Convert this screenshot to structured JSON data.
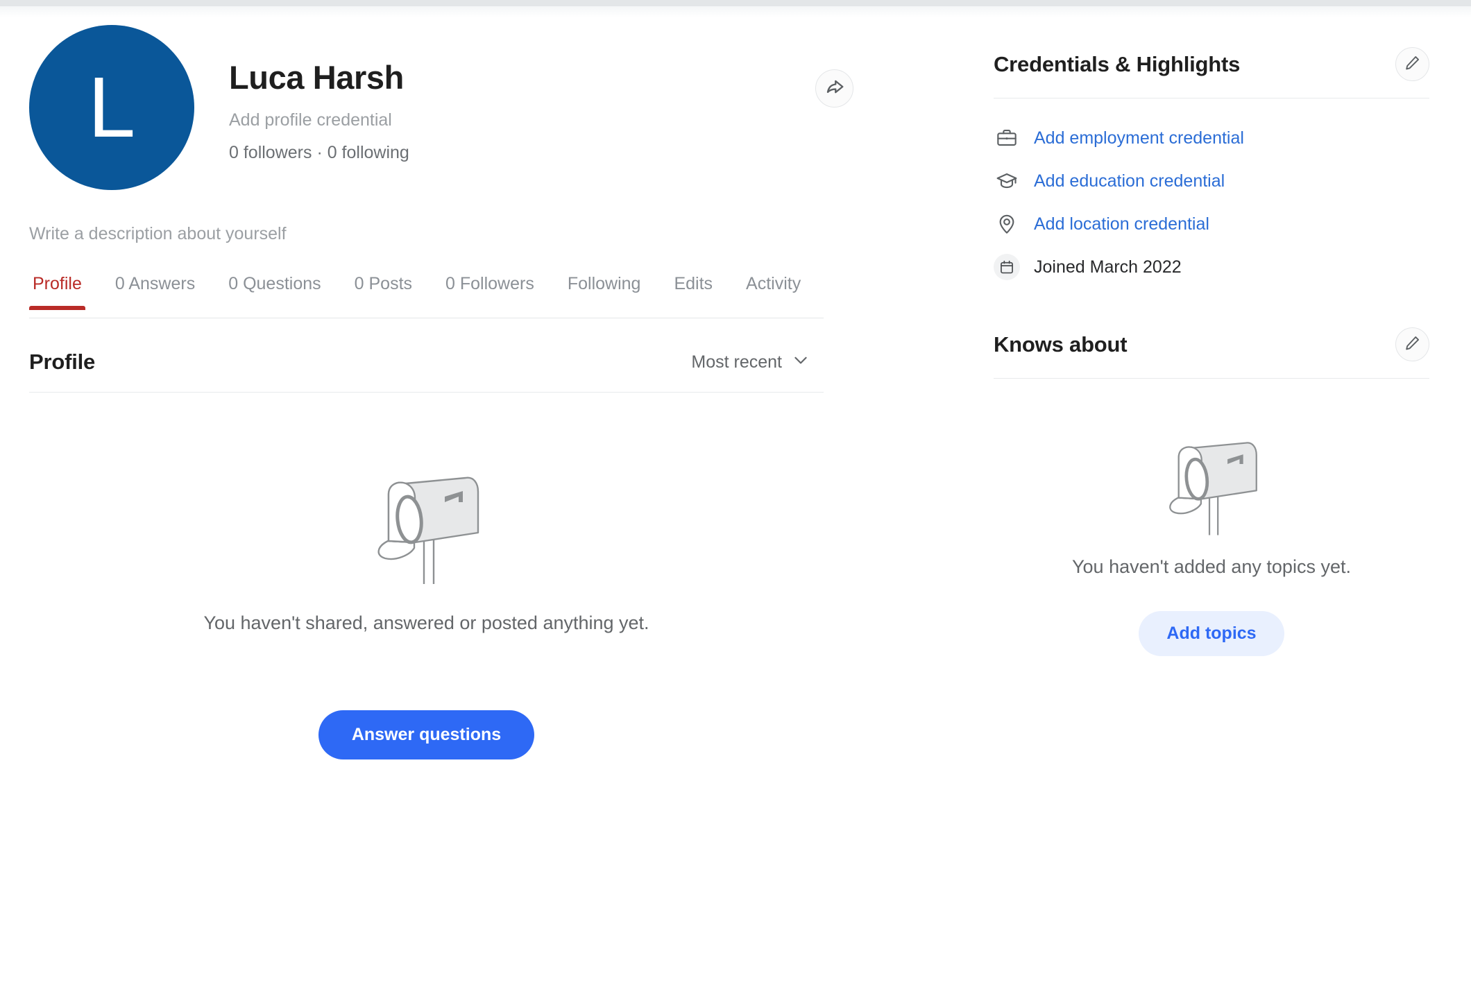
{
  "profile": {
    "avatar_initial": "L",
    "avatar_color": "#0a5799",
    "name": "Luca Harsh",
    "add_credential_label": "Add profile credential",
    "followers_line": "0 followers · 0 following",
    "description_placeholder": "Write a description about yourself",
    "share_icon": "share-arrow-icon"
  },
  "tabs": [
    {
      "label": "Profile",
      "active": true
    },
    {
      "label": "0 Answers",
      "active": false
    },
    {
      "label": "0 Questions",
      "active": false
    },
    {
      "label": "0 Posts",
      "active": false
    },
    {
      "label": "0 Followers",
      "active": false
    },
    {
      "label": "Following",
      "active": false
    },
    {
      "label": "Edits",
      "active": false
    },
    {
      "label": "Activity",
      "active": false
    }
  ],
  "main": {
    "section_title": "Profile",
    "sort_value": "Most recent",
    "sort_icon": "chevron-down-icon",
    "empty_illustration": "mailbox-illustration",
    "empty_text": "You haven't shared, answered or posted anything yet.",
    "primary_button": "Answer questions"
  },
  "sidebar": {
    "credentials": {
      "title": "Credentials & Highlights",
      "edit_icon": "pencil-icon",
      "items": [
        {
          "icon": "briefcase-icon",
          "label": "Add employment credential",
          "style": "link"
        },
        {
          "icon": "graduation-cap-icon",
          "label": "Add education credential",
          "style": "link"
        },
        {
          "icon": "location-pin-icon",
          "label": "Add location credential",
          "style": "link"
        },
        {
          "icon": "calendar-icon",
          "label": "Joined March 2022",
          "style": "plain"
        }
      ]
    },
    "knows_about": {
      "title": "Knows about",
      "edit_icon": "pencil-icon",
      "empty_illustration": "mailbox-illustration",
      "empty_text": "You haven't added any topics yet.",
      "button": "Add topics"
    }
  },
  "colors": {
    "accent_red": "#b92b27",
    "link_blue": "#2b6dd6",
    "primary_blue": "#2e69f5",
    "soft_blue": "#e9f0fe",
    "avatar_blue": "#0a5799"
  }
}
